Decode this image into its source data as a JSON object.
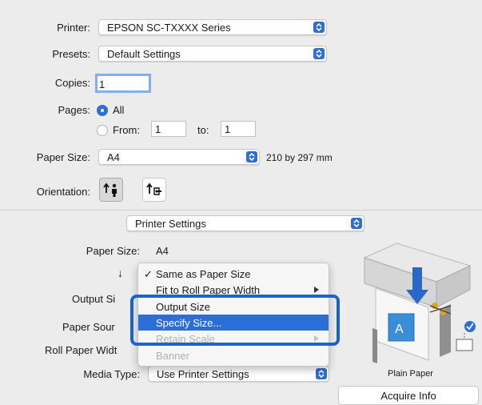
{
  "printer": {
    "label": "Printer:",
    "value": "EPSON SC-TXXXX Series"
  },
  "presets": {
    "label": "Presets:",
    "value": "Default Settings"
  },
  "copies": {
    "label": "Copies:",
    "value": "1"
  },
  "pages": {
    "label": "Pages:",
    "all_label": "All",
    "from_label": "From:",
    "from_value": "1",
    "to_label": "to:",
    "to_value": "1"
  },
  "paper_size_top": {
    "label": "Paper Size:",
    "value": "A4",
    "dimensions": "210 by 297 mm"
  },
  "orientation": {
    "label": "Orientation:"
  },
  "section_popup": {
    "value": "Printer Settings"
  },
  "settings": {
    "paper_size_label": "Paper Size:",
    "paper_size_value": "A4",
    "down_arrow": "↓",
    "output_size_label": "Output Si",
    "paper_source_label": "Paper Sour",
    "roll_paper_width_label": "Roll Paper Widt",
    "media_type_label": "Media Type:",
    "media_type_value": "Use Printer Settings"
  },
  "menu": {
    "items": [
      {
        "label": "Same as Paper Size",
        "checked": true,
        "submenu": false,
        "state": "normal"
      },
      {
        "label": "Fit to Roll Paper Width",
        "checked": false,
        "submenu": true,
        "state": "normal"
      },
      {
        "label": "Output Size",
        "checked": false,
        "submenu": false,
        "state": "normal"
      },
      {
        "label": "Specify Size...",
        "checked": false,
        "submenu": false,
        "state": "highlighted"
      },
      {
        "label": "Retain Scale",
        "checked": false,
        "submenu": true,
        "state": "disabled"
      },
      {
        "label": "Banner",
        "checked": false,
        "submenu": false,
        "state": "disabled"
      }
    ],
    "checkmark": "✓"
  },
  "preview": {
    "caption": "Plain Paper"
  },
  "acquire": {
    "label": "Acquire Info"
  },
  "colors": {
    "accent": "#2b6fd6",
    "callout": "#1d63d0"
  }
}
